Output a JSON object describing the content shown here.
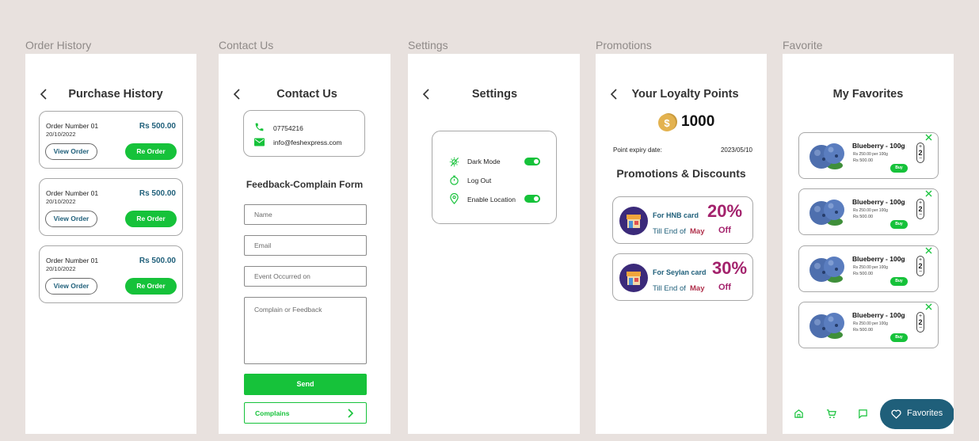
{
  "frame_labels": {
    "order_history": "Order History",
    "contact_us": "Contact Us",
    "settings": "Settings",
    "promotions": "Promotions",
    "favorite": "Favorite"
  },
  "order_history": {
    "title": "Purchase History",
    "orders": [
      {
        "number": "Order Number 01",
        "date": "20/10/2022",
        "amount": "Rs 500.00",
        "view_label": "View Order",
        "reorder_label": "Re Order"
      },
      {
        "number": "Order Number 01",
        "date": "20/10/2022",
        "amount": "Rs 500.00",
        "view_label": "View Order",
        "reorder_label": "Re Order"
      },
      {
        "number": "Order Number 01",
        "date": "20/10/2022",
        "amount": "Rs 500.00",
        "view_label": "View Order",
        "reorder_label": "Re Order"
      }
    ]
  },
  "contact_us": {
    "title": "Contact Us",
    "phone": "07754216",
    "email": "info@feshexpress.com",
    "form_title": "Feedback-Complain Form",
    "fields": {
      "name_placeholder": "Name",
      "email_placeholder": "Email",
      "event_placeholder": "Event Occurred on",
      "feedback_placeholder": "Complain or Feedback"
    },
    "send_label": "Send",
    "complains_label": "Complains"
  },
  "settings": {
    "title": "Settings",
    "items": [
      {
        "label": "Dark Mode"
      },
      {
        "label": "Log Out"
      },
      {
        "label": "Enable Location"
      }
    ]
  },
  "promotions": {
    "title": "Your Loyalty Points",
    "points": "1000",
    "expiry_label": "Point  expiry date:",
    "expiry_date": "2023/05/10",
    "section_title": "Promotions & Discounts",
    "cards": [
      {
        "card_name": "For HNB card",
        "till": "Till End of",
        "month": "May",
        "percent": "20%",
        "off": "Off"
      },
      {
        "card_name": "For Seylan card",
        "till": "Till End of",
        "month": "May",
        "percent": "30%",
        "off": "Off"
      }
    ]
  },
  "favorites": {
    "title": "My Favorites",
    "items": [
      {
        "name": "Blueberry - 100g",
        "unit_price": "Rs 250.00 per 100g",
        "price": "Rs 500.00",
        "qty": "2",
        "buy_label": "Buy"
      },
      {
        "name": "Blueberry - 100g",
        "unit_price": "Rs 250.00 per 100g",
        "price": "Rs 500.00",
        "qty": "2",
        "buy_label": "Buy"
      },
      {
        "name": "Blueberry - 100g",
        "unit_price": "Rs 250.00 per 100g",
        "price": "Rs 500.00",
        "qty": "2",
        "buy_label": "Buy"
      },
      {
        "name": "Blueberry - 100g",
        "unit_price": "Rs 250.00 per 100g",
        "price": "Rs 500.00",
        "qty": "2",
        "buy_label": "Buy"
      }
    ],
    "nav_active_label": "Favorites"
  },
  "colors": {
    "green": "#16c23a",
    "teal": "#1f5f7a",
    "magenta": "#a3226c",
    "background": "#e8e1de"
  }
}
